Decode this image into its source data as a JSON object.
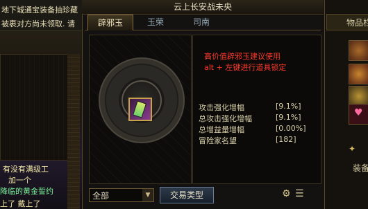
{
  "left_window": {
    "lines": [
      "地下城通宝装备抽珍藏",
      "被裹对方尚未领取. 请"
    ],
    "chat": [
      {
        "text": "有没有满级工",
        "color": "#f2e7a6"
      },
      {
        "text": "加一个",
        "color": "#f2e7a6"
      },
      {
        "text": "降临的黄金誓约",
        "color": "#7cf29a"
      },
      {
        "text": "上了 戴上了",
        "color": "#f2e7a6"
      }
    ]
  },
  "right_window": {
    "tab": "物品栏",
    "equip": "装备"
  },
  "dialog": {
    "title": "云上长安战未央",
    "tabs": [
      {
        "label": "辟邪玉",
        "active": true
      },
      {
        "label": "玉荣",
        "active": false
      },
      {
        "label": "司南",
        "active": false
      }
    ],
    "item_icon": "jade-card-icon",
    "notice": [
      "高价值辟邪玉建议使用",
      "alt + 左键进行道具锁定"
    ],
    "stats": [
      {
        "label": "攻击强化增幅",
        "value": "[9.1%]"
      },
      {
        "label": "总攻击强化增幅",
        "value": "[9.1%]"
      },
      {
        "label": "总增益量增幅",
        "value": "[0.00%]"
      },
      {
        "label": "冒险家名望",
        "value": "[182]"
      }
    ],
    "filter": {
      "value": "全部"
    },
    "trade_button": "交易类型",
    "icons": {
      "settings": "gear-icon",
      "list": "list-icon"
    }
  },
  "colors": {
    "notice": "#ff3a2a",
    "gold_border": "#c9a14b"
  }
}
